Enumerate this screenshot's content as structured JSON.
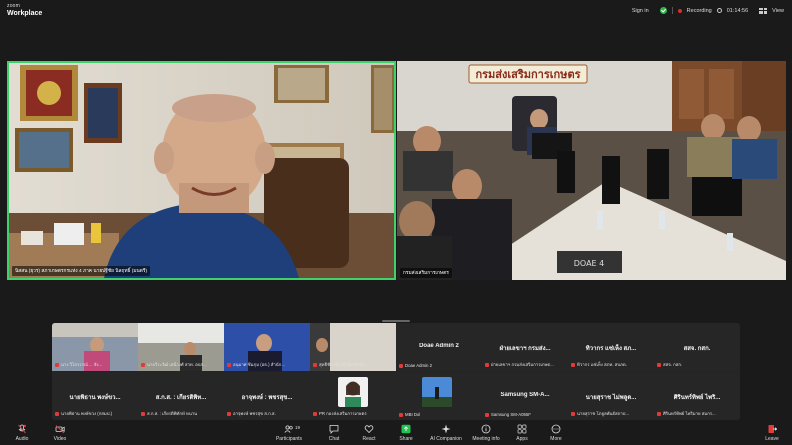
{
  "app": {
    "brand_top": "zoom",
    "brand_name": "Workplace"
  },
  "topbar": {
    "sign_in": "Sign in",
    "recording": "Recording",
    "timer": "01:14:56",
    "view": "View"
  },
  "main": {
    "left_caption": "นิสสน (ยุวร) สภาเกษตรกรแห่ง 4 ภาค นายปฐีชัย นิลฤทธิ์ (มนตรี)",
    "right_caption": "กรมส่งเสริมการเกษตร",
    "sign_text": "กรมส่งเสริมการเกษตร",
    "desk_label": "DOAE 4"
  },
  "gallery": [
    {
      "name": "",
      "label": "นาง วิไลวรรณ์ ... จัง...",
      "muted": true
    },
    {
      "name": "",
      "label": "นายวีระวัฒ์ เสนีวงศ์ สวท. อปภ...",
      "muted": true
    },
    {
      "name": "",
      "label": "อนุมาศ ซีมภุม (อธ.) สำนัก...",
      "muted": true
    },
    {
      "name": "",
      "label": "สุทธิชัย เนื่องจำนง สำนัก...",
      "muted": true
    },
    {
      "name": "Doae Admin 2",
      "label": "Doae Admin 2",
      "muted": true
    },
    {
      "name": "ฝ่ายเลขาฯ กรมส่ง...",
      "label": "ฝ่ายเลขาฯ กรมส่งเสริมการเกษต...",
      "muted": true
    },
    {
      "name": "ทิวากร แซ่เห็ง สภ...",
      "label": "ทิวากร แซ่เห็ง สภท. สบภด.",
      "muted": true
    },
    {
      "name": "สสจ. กสก.",
      "label": "สสจ. กสก.",
      "muted": true
    },
    {
      "name": "นายพิธาน พงษ์ขว...",
      "label": "นายพิธาน พงษ์ขวง (กสมป.)",
      "muted": true
    },
    {
      "name": "ส.ก.ส. : เกียรติพิท...",
      "label": "ส.ก.ส. : เกียรติพิทักษ์ หนาน",
      "muted": true
    },
    {
      "name": "อาจุพงษ์ : พชรสุข...",
      "label": "อาจุพงษ์ พชรสุข ส.ก.ส.",
      "muted": true
    },
    {
      "name": "",
      "label": "PR กองส่งเสริมการเกษตร",
      "muted": true
    },
    {
      "name": "",
      "label": "MBI Dol",
      "muted": true
    },
    {
      "name": "Samsung SM-A...",
      "label": "Samsung SM-A055F",
      "muted": true
    },
    {
      "name": "นายสุราช ไม่พลูด...",
      "label": "นายสุราช โภยูลพันธ์สถาป...",
      "muted": true
    },
    {
      "name": "ศิรินทร์ทิพย์ ไพริ...",
      "label": "ศิรินทร์ทิพย์ ไพริมาย สมกร...",
      "muted": true
    }
  ],
  "toolbar": {
    "audio": "Audio",
    "video": "Video",
    "participants": "Participants",
    "participants_count": "19",
    "chat": "Chat",
    "react": "React",
    "share": "Share",
    "ai_companion": "AI Companion",
    "meeting_info": "Meeting info",
    "apps": "Apps",
    "more": "More",
    "leave": "Leave"
  },
  "colors": {
    "active_speaker": "#3fd16a",
    "share": "#1fc44f",
    "muted": "#e03a3a",
    "leave": "#e23c3c"
  }
}
